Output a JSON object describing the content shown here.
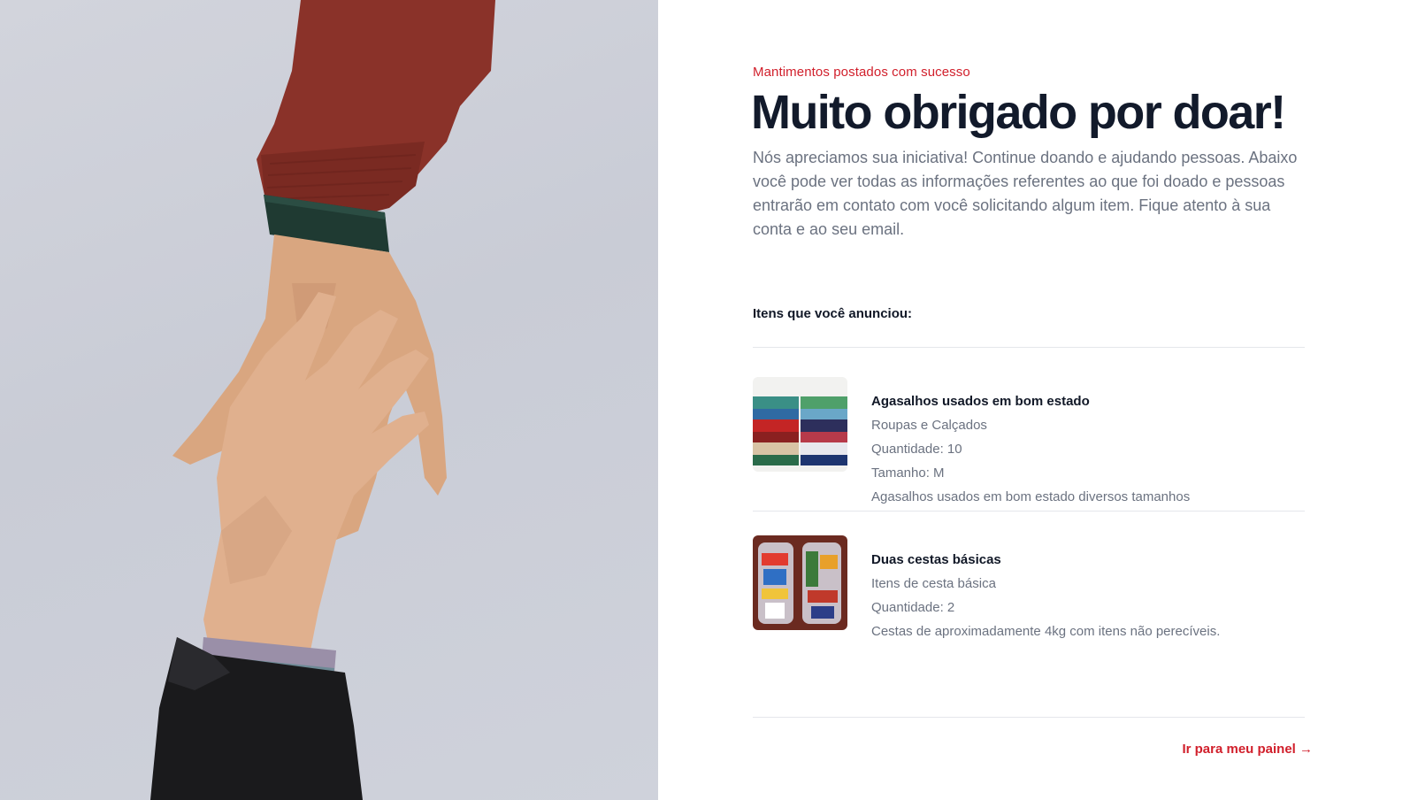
{
  "hero": {
    "image_alt": "hands-reaching-photo"
  },
  "header": {
    "eyebrow": "Mantimentos postados com sucesso",
    "title": "Muito obrigado por doar!",
    "lead": "Nós apreciamos sua iniciativa! Continue doando e ajudando pessoas. Abaixo você pode ver todas as informações referentes ao que foi doado e pessoas entrarão em contato com você solicitando algum item. Fique atento à sua conta e ao seu email."
  },
  "items_section": {
    "label": "Itens que você anunciou:",
    "items": [
      {
        "name": "Agasalhos usados em bom estado",
        "category": "Roupas e Calçados",
        "quantity": "Quantidade: 10",
        "size": "Tamanho: M",
        "description": "Agasalhos usados em bom estado diversos tamanhos",
        "thumb_icon": "folded-clothes-photo"
      },
      {
        "name": "Duas cestas básicas",
        "category": "Itens de cesta básica",
        "quantity": "Quantidade: 2",
        "description": "Cestas de aproximadamente 4kg com itens não perecíveis.",
        "thumb_icon": "grocery-basket-photo"
      }
    ]
  },
  "footer": {
    "cta_label": "Ir para meu painel →"
  },
  "colors": {
    "accent": "#d11f2b",
    "title": "#121a2b",
    "muted": "#6b7280"
  }
}
